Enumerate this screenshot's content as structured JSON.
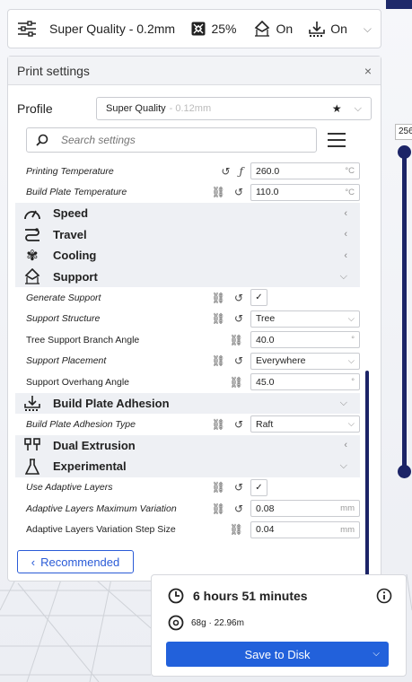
{
  "header": {
    "profile_label": "Super Quality - 0.2mm",
    "infill_value": "25%",
    "support_value": "On",
    "adhesion_value": "On"
  },
  "panel": {
    "title": "Print settings",
    "close": "×"
  },
  "profile": {
    "label": "Profile",
    "name": "Super Quality",
    "suffix": " - 0.12mm"
  },
  "search": {
    "placeholder": "Search settings"
  },
  "settings": {
    "printing_temperature": {
      "label": "Printing Temperature",
      "value": "260.0",
      "unit": "°C"
    },
    "build_plate_temperature": {
      "label": "Build Plate Temperature",
      "value": "110.0",
      "unit": "°C"
    },
    "generate_support": {
      "label": "Generate Support",
      "check": "✓"
    },
    "support_structure": {
      "label": "Support Structure",
      "value": "Tree"
    },
    "tree_branch_angle": {
      "label": "Tree Support Branch Angle",
      "value": "40.0",
      "unit": "°"
    },
    "support_placement": {
      "label": "Support Placement",
      "value": "Everywhere"
    },
    "support_overhang_angle": {
      "label": "Support Overhang Angle",
      "value": "45.0",
      "unit": "°"
    },
    "adhesion_type": {
      "label": "Build Plate Adhesion Type",
      "value": "Raft"
    },
    "use_adaptive_layers": {
      "label": "Use Adaptive Layers",
      "check": "✓"
    },
    "adaptive_max_variation": {
      "label": "Adaptive Layers Maximum Variation",
      "value": "0.08",
      "unit": "mm"
    },
    "adaptive_step_size": {
      "label": "Adaptive Layers Variation Step Size",
      "value": "0.04",
      "unit": "mm"
    }
  },
  "categories": {
    "speed": "Speed",
    "travel": "Travel",
    "cooling": "Cooling",
    "support": "Support",
    "adhesion": "Build Plate Adhesion",
    "dual": "Dual Extrusion",
    "experimental": "Experimental"
  },
  "recommended_label": "Recommended",
  "layer_value": "256",
  "output": {
    "time": "6 hours 51 minutes",
    "material": "68g · 22.96m",
    "save_label": "Save to Disk"
  },
  "colors": {
    "accent": "#2261db",
    "dark_navy": "#1c2467"
  }
}
